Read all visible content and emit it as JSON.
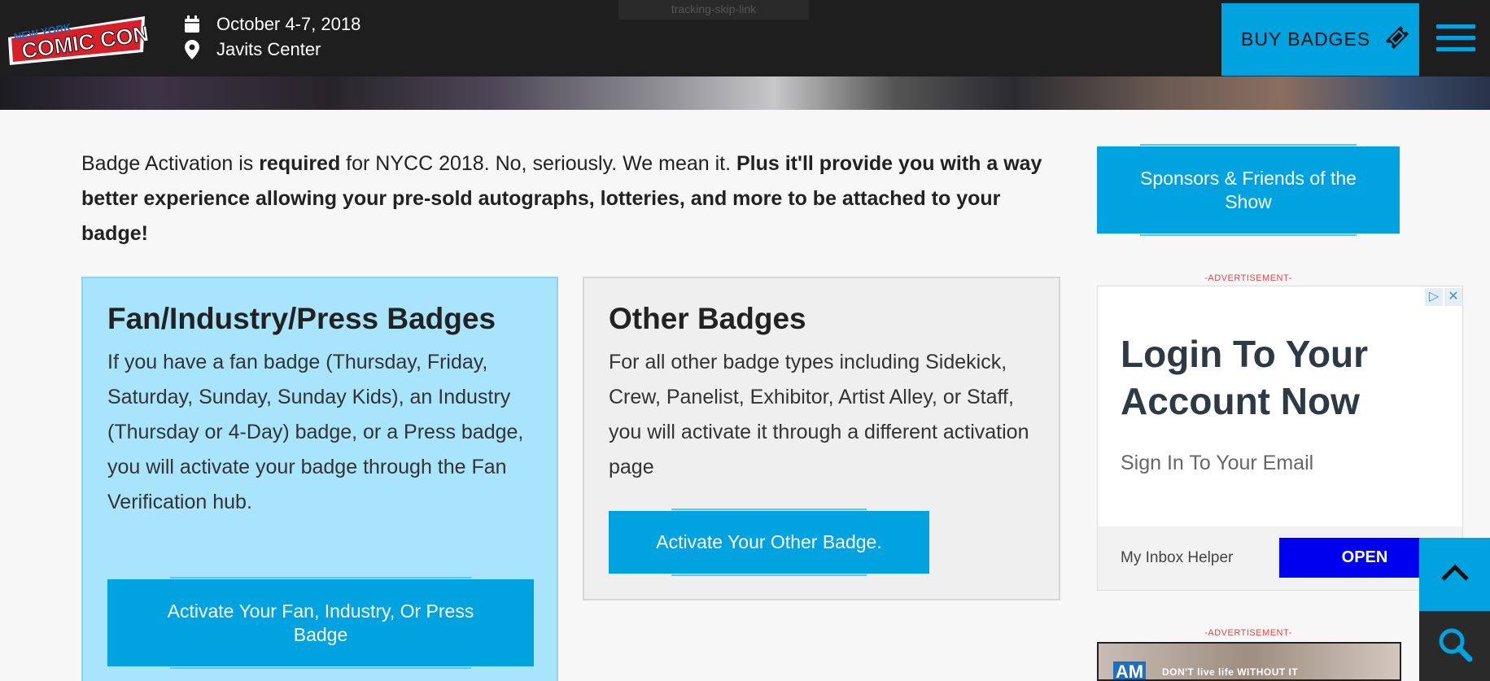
{
  "header": {
    "logo_top": "NEW YORK",
    "logo_main": "COMIC CON",
    "date": "October 4-7, 2018",
    "venue": "Javits Center",
    "ghost_tab": "tracking-skip-link",
    "buy_label": "BUY BADGES",
    "icons": [
      "calendar-icon",
      "location-pin-icon",
      "ticket-icon",
      "hamburger-menu-icon"
    ]
  },
  "intro": {
    "part1": "Badge Activation is ",
    "bold1": "required",
    "part2": " for NYCC 2018. No, seriously. We mean it. ",
    "bold2": "Plus it'll provide you with a way better experience allowing your pre-sold autographs, lotteries, and more to be attached to your badge!"
  },
  "cards": {
    "fan": {
      "title": "Fan/Industry/Press Badges",
      "body": "If you have a fan badge (Thursday, Friday, Saturday, Sunday, Sunday Kids), an Industry (Thursday or 4-Day) badge, or a Press badge, you will activate your badge through the Fan Verification hub.",
      "button": "Activate Your Fan, Industry, Or Press Badge"
    },
    "other": {
      "title": "Other Badges",
      "body": "For all other badge types including Sidekick, Crew, Panelist, Exhibitor, Artist Alley, or Staff, you will activate it through a different activation page",
      "button": "Activate Your Other Badge."
    }
  },
  "sidebar": {
    "sponsors_button": "Sponsors & Friends of the Show",
    "ad_label": "-ADVERTISEMENT-",
    "ad": {
      "title": "Login To Your Account Now",
      "subtitle": "Sign In To Your Email",
      "footer_label": "My Inbox Helper",
      "open_button": "OPEN"
    },
    "ad2": {
      "brand": "AM",
      "tagline": "DON'T live life WITHOUT IT"
    }
  },
  "colors": {
    "accent": "#00a3e0",
    "header_bg": "#1e1e1e",
    "fan_card_bg": "#a8e4fb",
    "other_card_bg": "#efefef",
    "ad_button": "#0000f0",
    "ad_label": "#e0474c"
  }
}
